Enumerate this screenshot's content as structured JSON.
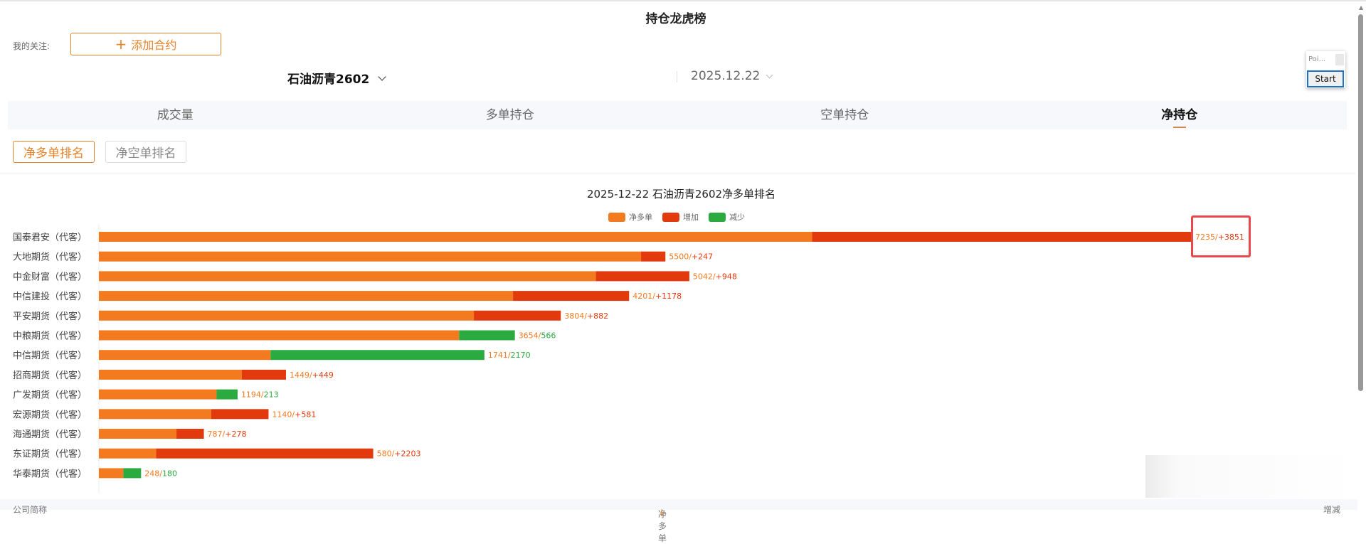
{
  "page_title": "持仓龙虎榜",
  "follow": {
    "label": "我的关注:",
    "add_icon": "+",
    "add_label": "添加合约"
  },
  "contract": "石油沥青2602",
  "date": "2025.12.22",
  "tabs": [
    {
      "label": "成交量",
      "active": false
    },
    {
      "label": "多单持仓",
      "active": false
    },
    {
      "label": "空单持仓",
      "active": false
    },
    {
      "label": "净持仓",
      "active": true
    }
  ],
  "sub_tabs": [
    {
      "label": "净多单排名",
      "active": true
    },
    {
      "label": "净空单排名",
      "active": false
    }
  ],
  "popup": {
    "title": "Poi...",
    "button": "Start"
  },
  "table_header": {
    "company": "公司简称",
    "net_long": "净多单",
    "sort_icon": "↓",
    "change": "增减"
  },
  "colors": {
    "net": "#f47a1f",
    "increase": "#e23a0c",
    "decrease": "#2bab3f",
    "accent": "#e5832a"
  },
  "chart_data": {
    "type": "bar",
    "orientation": "horizontal-stacked",
    "title": "2025-12-22 石油沥青2602净多单排名",
    "legend": [
      "净多单",
      "增加",
      "减少"
    ],
    "legend_position": "top-center",
    "categories": [
      "国泰君安（代客）",
      "大地期货（代客）",
      "中金财富（代客）",
      "中信建投（代客）",
      "平安期货（代客）",
      "中粮期货（代客）",
      "中信期货（代客）",
      "招商期货（代客）",
      "广发期货（代客）",
      "宏源期货（代客）",
      "海通期货（代客）",
      "东证期货（代客）",
      "华泰期货（代客）"
    ],
    "net": [
      7235,
      5500,
      5042,
      4201,
      3804,
      3654,
      1741,
      1449,
      1194,
      1140,
      787,
      580,
      248
    ],
    "change": [
      3851,
      247,
      948,
      1178,
      882,
      -566,
      -2170,
      449,
      -213,
      581,
      278,
      2203,
      -180
    ],
    "labels": [
      "7235/+3851",
      "5500/+247",
      "5042/+948",
      "4201/+1178",
      "3804/+882",
      "3654/566",
      "1741/2170",
      "1449/+449",
      "1194/213",
      "1140/+581",
      "787/+278",
      "580/+2203",
      "248/180"
    ],
    "xlim": [
      0,
      11086
    ]
  }
}
